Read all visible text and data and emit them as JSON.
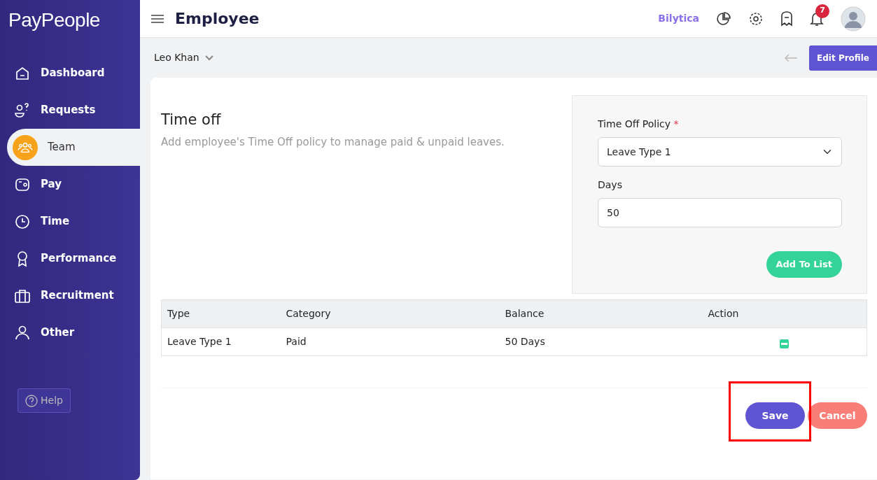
{
  "logo": {
    "text": "PayPeople"
  },
  "sidebar": {
    "items": [
      {
        "label": "Dashboard",
        "selected": false
      },
      {
        "label": "Requests",
        "selected": false
      },
      {
        "label": "Team",
        "selected": true
      },
      {
        "label": "Pay",
        "selected": false
      },
      {
        "label": "Time",
        "selected": false
      },
      {
        "label": "Performance",
        "selected": false
      },
      {
        "label": "Recruitment",
        "selected": false
      },
      {
        "label": "Other",
        "selected": false
      }
    ],
    "help": "Help"
  },
  "header": {
    "title": "Employee",
    "brand": "Bilytica",
    "notification_count": "7"
  },
  "subheader": {
    "employee": "Leo Khan",
    "edit_button": "Edit Profile"
  },
  "section": {
    "title": "Time off",
    "description": "Add employee's Time Off policy to manage paid & unpaid leaves."
  },
  "form": {
    "policy_label": "Time Off Policy",
    "required_mark": "*",
    "policy_value": "Leave Type 1",
    "days_label": "Days",
    "days_value": "50",
    "add_button": "Add To List"
  },
  "table": {
    "columns": [
      "Type",
      "Category",
      "Balance",
      "Action"
    ],
    "rows": [
      {
        "type": "Leave Type 1",
        "category": "Paid",
        "balance": "50 Days"
      }
    ]
  },
  "buttons": {
    "save": "Save",
    "cancel": "Cancel"
  }
}
